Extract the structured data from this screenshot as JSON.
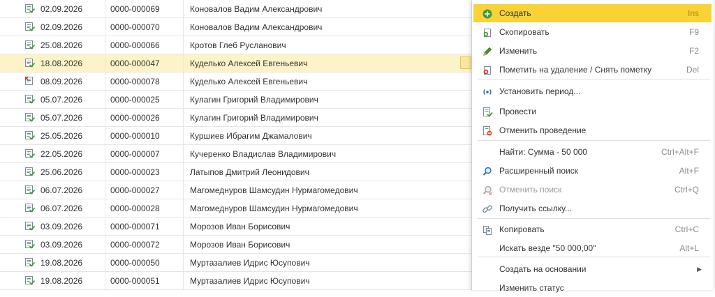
{
  "rows": [
    {
      "date": "02.09.2026",
      "number": "0000-000069",
      "name": "Коновалов Вадим Александрович",
      "status": "posted"
    },
    {
      "date": "02.09.2026",
      "number": "0000-000070",
      "name": "Коновалов Вадим Александрович",
      "status": "posted"
    },
    {
      "date": "25.08.2026",
      "number": "0000-000066",
      "name": "Кротов Глеб Русланович",
      "status": "posted"
    },
    {
      "date": "18.08.2026",
      "number": "0000-000047",
      "name": "Куделько Алексей Евгеньевич",
      "status": "posted",
      "selected": true
    },
    {
      "date": "08.09.2026",
      "number": "0000-000078",
      "name": "Куделько Алексей Евгеньевич",
      "status": "deleted"
    },
    {
      "date": "05.07.2026",
      "number": "0000-000025",
      "name": "Кулагин Григорий Владимирович",
      "status": "posted"
    },
    {
      "date": "05.07.2026",
      "number": "0000-000026",
      "name": "Кулагин Григорий Владимирович",
      "status": "posted"
    },
    {
      "date": "25.05.2026",
      "number": "0000-000010",
      "name": "Куршиев Ибрагим Джамалович",
      "status": "posted"
    },
    {
      "date": "22.05.2026",
      "number": "0000-000007",
      "name": "Кучеренко Владислав Владимирович",
      "status": "posted"
    },
    {
      "date": "25.06.2026",
      "number": "0000-000023",
      "name": "Латыпов Дмитрий Леонидович",
      "status": "posted"
    },
    {
      "date": "06.07.2026",
      "number": "0000-000027",
      "name": "Магомеднуров Шамсудин Нурмагомедович",
      "status": "posted"
    },
    {
      "date": "06.07.2026",
      "number": "0000-000028",
      "name": "Магомеднуров Шамсудин Нурмагомедович",
      "status": "posted"
    },
    {
      "date": "03.09.2026",
      "number": "0000-000071",
      "name": "Морозов Иван Борисович",
      "status": "posted"
    },
    {
      "date": "03.09.2026",
      "number": "0000-000072",
      "name": "Морозов Иван Борисович",
      "status": "posted"
    },
    {
      "date": "19.08.2026",
      "number": "0000-000050",
      "name": "Муртазалиев Идрис Юсупович",
      "status": "posted"
    },
    {
      "date": "19.08.2026",
      "number": "0000-000051",
      "name": "Муртазалиев Идрис Юсупович",
      "status": "posted"
    }
  ],
  "menu": {
    "items": [
      {
        "label": "Создать",
        "shortcut": "Ins",
        "icon": "plus-circle-icon",
        "active": true
      },
      {
        "label": "Скопировать",
        "shortcut": "F9",
        "icon": "copy-document-icon"
      },
      {
        "label": "Изменить",
        "shortcut": "F2",
        "icon": "pencil-icon"
      },
      {
        "label": "Пометить на удаление / Снять пометку",
        "shortcut": "Del",
        "icon": "mark-delete-icon"
      },
      {
        "label": "Установить период...",
        "shortcut": "",
        "icon": "period-icon"
      },
      {
        "label": "Провести",
        "shortcut": "",
        "icon": "post-document-icon"
      },
      {
        "label": "Отменить проведение",
        "shortcut": "",
        "icon": "unpost-document-icon"
      },
      {
        "label": "Найти: Сумма - 50 000",
        "shortcut": "Ctrl+Alt+F",
        "icon": ""
      },
      {
        "label": "Расширенный поиск",
        "shortcut": "Alt+F",
        "icon": "search-icon"
      },
      {
        "label": "Отменить поиск",
        "shortcut": "Ctrl+Q",
        "icon": "cancel-search-icon",
        "disabled": true
      },
      {
        "label": "Получить ссылку...",
        "shortcut": "",
        "icon": "link-icon"
      },
      {
        "label": "Копировать",
        "shortcut": "Ctrl+C",
        "icon": "copy-icon"
      },
      {
        "label": "Искать везде \"50 000,00\"",
        "shortcut": "Alt+L",
        "icon": ""
      },
      {
        "label": "Создать на основании",
        "shortcut": "",
        "icon": "",
        "submenu": true
      },
      {
        "label": "Изменить статус",
        "shortcut": "",
        "icon": ""
      }
    ]
  },
  "colors": {
    "highlight": "#f9d235",
    "selected_row": "#fdf3c9",
    "posted_icon": "#3aa33a",
    "deleted_icon": "#d32f2f"
  }
}
